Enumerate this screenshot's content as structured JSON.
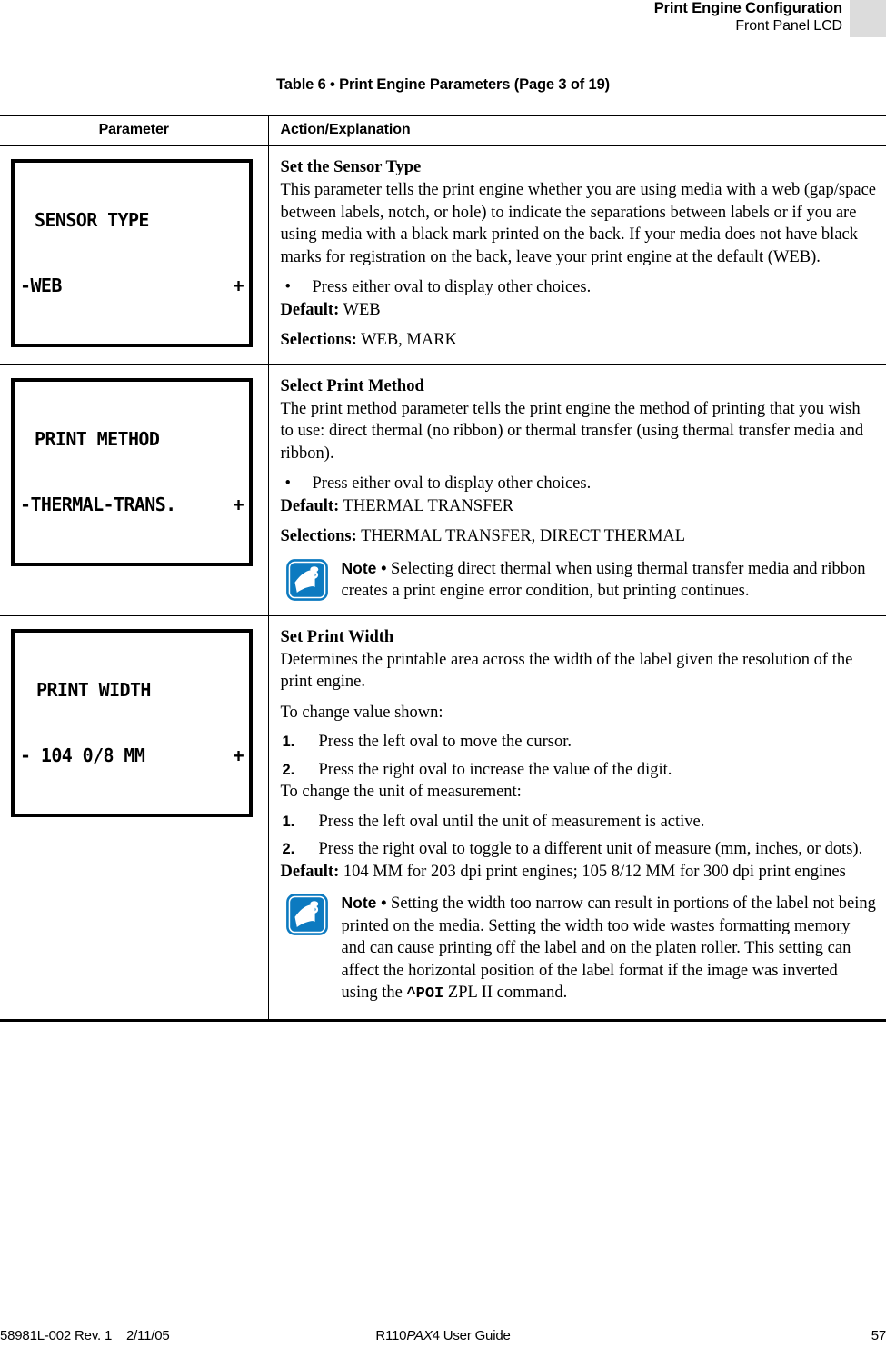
{
  "header": {
    "title": "Print Engine Configuration",
    "subtitle": "Front Panel LCD"
  },
  "caption": "Table 6 • Print Engine Parameters (Page 3 of 19)",
  "table": {
    "columns": {
      "parameter": "Parameter",
      "action": "Action/Explanation"
    },
    "rows": [
      {
        "lcd": {
          "title": "SENSOR TYPE",
          "left": "-WEB",
          "right": "+"
        },
        "heading": "Set the Sensor Type",
        "paragraphs": [
          "This parameter tells the print engine whether you are using media with a web (gap/space between labels, notch, or hole) to indicate the separations between labels or if you are using media with a black mark printed on the back. If your media does not have black marks for registration on the back, leave your print engine at the default (WEB)."
        ],
        "bullets": [
          "Press either oval to display other choices."
        ],
        "default_label": "Default:",
        "default_value": "WEB",
        "selections_label": "Selections:",
        "selections_value": "WEB, MARK"
      },
      {
        "lcd": {
          "title": "PRINT METHOD",
          "left": "-THERMAL-TRANS.",
          "right": "+"
        },
        "heading": "Select Print Method",
        "paragraphs": [
          "The print method parameter tells the print engine the method of printing that you wish to use: direct thermal (no ribbon) or thermal transfer (using thermal transfer media and ribbon)."
        ],
        "bullets": [
          "Press either oval to display other choices."
        ],
        "default_label": "Default:",
        "default_value": "THERMAL TRANSFER",
        "selections_label": "Selections:",
        "selections_value": "THERMAL TRANSFER, DIRECT THERMAL",
        "note": {
          "word": "Note •",
          "text": " Selecting direct thermal when using thermal transfer media and ribbon creates a print engine error condition, but printing continues."
        }
      },
      {
        "lcd": {
          "title": "PRINT WIDTH",
          "left": "- 104 0/8 MM",
          "right": "+"
        },
        "heading": "Set Print Width",
        "paragraphs": [
          "Determines the printable area across the width of the label given the resolution of the print engine.",
          "To change value shown:"
        ],
        "steps_a": [
          "Press the left oval to move the cursor.",
          "Press the right oval to increase the value of the digit."
        ],
        "intro_b": "To change the unit of measurement:",
        "steps_b": [
          "Press the left oval until the unit of measurement is active.",
          "Press the right oval to toggle to a different unit of measure (mm, inches, or dots)."
        ],
        "default_label": "Default:",
        "default_value": "104 MM for 203 dpi print engines; 105 8/12 MM for 300 dpi print engines",
        "note": {
          "word": "Note •",
          "text_before": " Setting the width too narrow can result in portions of the label not being printed on the media. Setting the width too wide wastes formatting memory and can cause printing off the label and on the platen roller. This setting can affect the horizontal position of the label format if the image was inverted using the ",
          "command": "^POI",
          "text_after": " ZPL II command."
        }
      }
    ]
  },
  "footer": {
    "left": "58981L-002 Rev. 1    2/11/05",
    "center_plain_a": "R110",
    "center_italic": "PAX",
    "center_plain_b": "4 User Guide",
    "page_number": "57"
  },
  "colors": {
    "zebra_blue": "#0c7ac0",
    "header_block_gray": "#dcdcdc",
    "rule": "#000000"
  }
}
